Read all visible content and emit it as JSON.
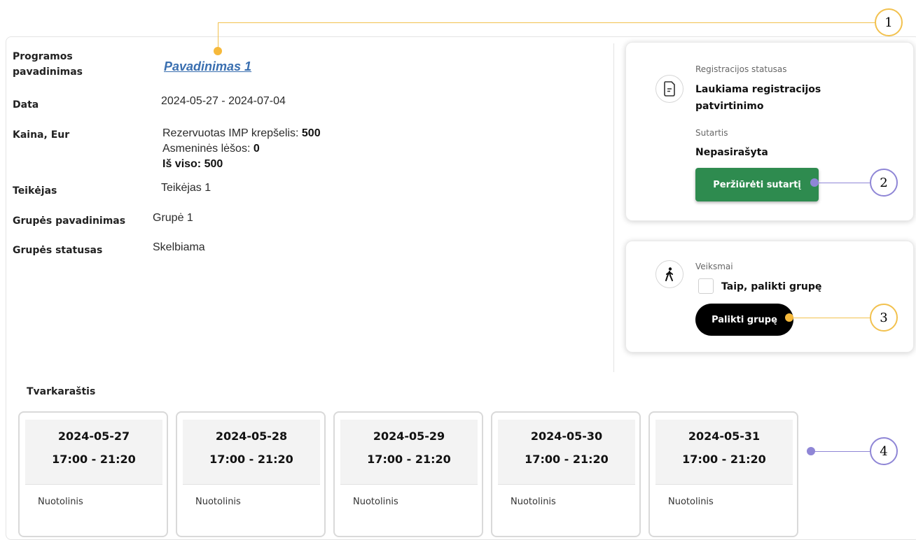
{
  "program": {
    "name_label": "Programos pavadinimas",
    "name_value": "Pavadinimas 1",
    "date_label": "Data",
    "date_value": "2024-05-27 - 2024-07-04",
    "price_label": "Kaina, Eur",
    "price_reserved_label": "Rezervuotas IMP krepšelis:",
    "price_reserved_value": "500",
    "price_personal_label": "Asmeninės lėšos:",
    "price_personal_value": "0",
    "price_total_label": "Iš viso:",
    "price_total_value": "500",
    "provider_label": "Teikėjas",
    "provider_value": "Teikėjas 1",
    "group_name_label": "Grupės pavadinimas",
    "group_name_value": "Grupė 1",
    "group_status_label": "Grupės statusas",
    "group_status_value": "Skelbiama"
  },
  "registration": {
    "status_label": "Registracijos statusas",
    "status_value": "Laukiama registracijos patvirtinimo",
    "contract_label": "Sutartis",
    "contract_value": "Nepasirašyta",
    "view_contract_button": "Peržiūrėti sutartį",
    "icon": "document-icon"
  },
  "actions": {
    "label": "Veiksmai",
    "checkbox_label": "Taip, palikti grupę",
    "leave_button": "Palikti grupę",
    "icon": "walking-person-icon"
  },
  "schedule": {
    "title": "Tvarkaraštis",
    "items": [
      {
        "date": "2024-05-27",
        "time": "17:00 - 21:20",
        "mode": "Nuotolinis"
      },
      {
        "date": "2024-05-28",
        "time": "17:00 - 21:20",
        "mode": "Nuotolinis"
      },
      {
        "date": "2024-05-29",
        "time": "17:00 - 21:20",
        "mode": "Nuotolinis"
      },
      {
        "date": "2024-05-30",
        "time": "17:00 - 21:20",
        "mode": "Nuotolinis"
      },
      {
        "date": "2024-05-31",
        "time": "17:00 - 21:20",
        "mode": "Nuotolinis"
      }
    ]
  },
  "callouts": [
    "1",
    "2",
    "3",
    "4"
  ],
  "colors": {
    "link": "#3a6fb0",
    "green_button": "#2e8b4f",
    "callout_yellow": "#f2c14e",
    "callout_purple": "#8f86d6"
  }
}
